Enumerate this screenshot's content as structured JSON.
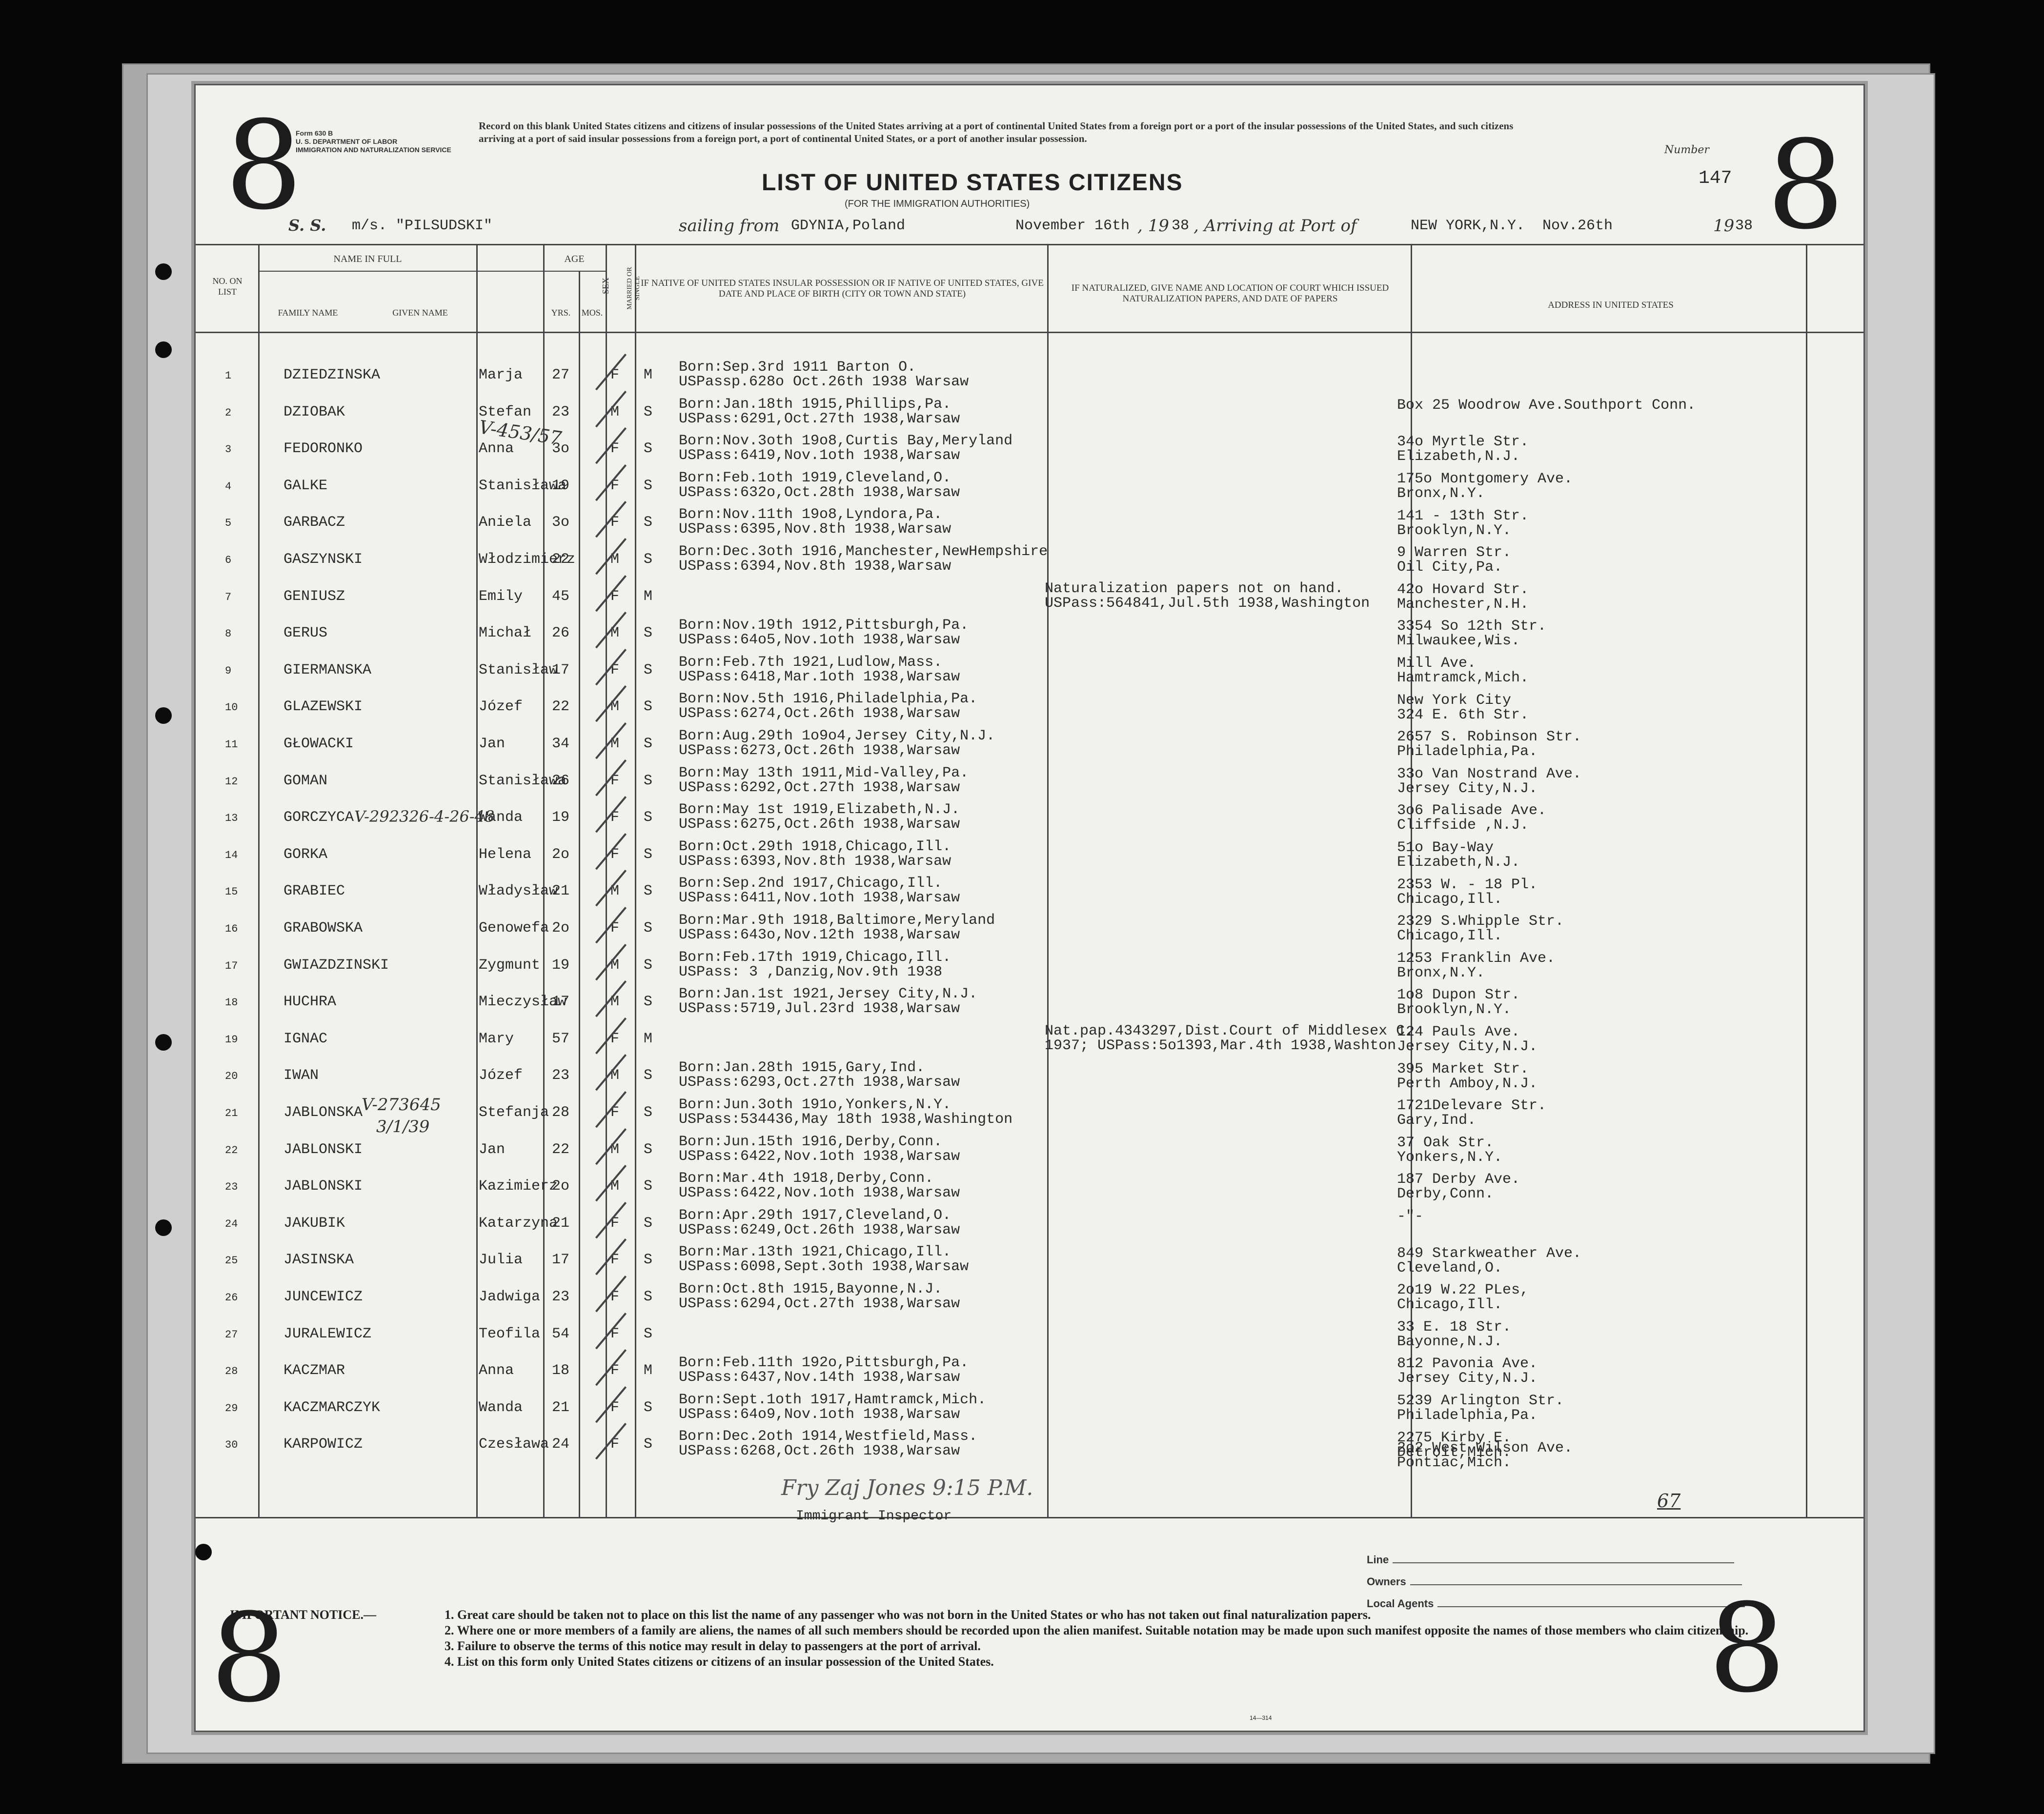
{
  "form": {
    "big_number": "8",
    "form_id": "Form 630 B",
    "dept": "U. S. DEPARTMENT OF LABOR",
    "service": "IMMIGRATION AND NATURALIZATION SERVICE",
    "instructions": "Record on this blank United States citizens and citizens of insular possessions of the United States arriving at a port of continental United States from a foreign port or a port of the insular possessions of the United States, and such citizens arriving at a port of said insular possessions from a foreign port, a port of continental United States, or a port of another insular possession.",
    "number_label": "Number",
    "number_value": "147",
    "title": "LIST OF UNITED STATES CITIZENS",
    "subtitle": "(FOR THE IMMIGRATION AUTHORITIES)",
    "gpo": "14—314"
  },
  "voyage": {
    "ss_label": "S. S.",
    "ship": "m/s. \"PILSUDSKI\"",
    "sailing_label": "sailing from",
    "from": "GDYNIA,Poland",
    "departure_date": "November 16th",
    "year_label": ", 19",
    "departure_year": "38",
    "arriving_label": ", Arriving at Port of",
    "port": "NEW YORK,N.Y.",
    "arrival_date": "Nov.26th",
    "arrival_year": "38"
  },
  "headers": {
    "no": "No. on List",
    "name_in_full": "NAME IN FULL",
    "family": "Family Name",
    "given": "Given Name",
    "age": "AGE",
    "yrs": "Yrs.",
    "mos": "Mos.",
    "sex": "Sex",
    "married": "Married or Single",
    "birth": "If native of United States insular possession or if native of United States, give date and place of birth (city or town and state)",
    "naturalized": "If naturalized, give name and location of court which issued naturalization papers, and date of papers",
    "address": "Address in United States"
  },
  "rows": [
    {
      "no": "1",
      "family": "DZIEDZINSKA",
      "given": "Marja",
      "age": "27",
      "sex": "F",
      "ms": "M",
      "birth": "Born:Sep.3rd 1911 Barton O.",
      "pass": "USPassp.628o Oct.26th 1938 Warsaw",
      "nat1": "",
      "nat2": "",
      "addr1": "",
      "addr2": ""
    },
    {
      "no": "2",
      "family": "DZIOBAK",
      "given": "Stefan",
      "age": "23",
      "sex": "M",
      "ms": "S",
      "birth": "Born:Jan.18th 1915,Phillips,Pa.",
      "pass": "USPass:6291,Oct.27th 1938,Warsaw",
      "nat1": "",
      "nat2": "",
      "addr1": "Box 25 Woodrow Ave.Southport Conn.",
      "addr2": ""
    },
    {
      "no": "3",
      "family": "FEDORONKO",
      "given": "Anna",
      "age": "3o",
      "sex": "F",
      "ms": "S",
      "birth": "Born:Nov.3oth 19o8,Curtis  Bay,Meryland",
      "pass": "USPass:6419,Nov.1oth 1938,Warsaw",
      "nat1": "",
      "nat2": "",
      "addr1": "34o Myrtle Str.",
      "addr2": "Elizabeth,N.J."
    },
    {
      "no": "4",
      "family": "GALKE",
      "given": "Stanisława",
      "age": "19",
      "sex": "F",
      "ms": "S",
      "birth": "Born:Feb.1oth 1919,Cleveland,O.",
      "pass": "USPass:632o,Oct.28th 1938,Warsaw",
      "nat1": "",
      "nat2": "",
      "addr1": "175o Montgomery Ave.",
      "addr2": "Bronx,N.Y."
    },
    {
      "no": "5",
      "family": "GARBACZ",
      "given": "Aniela",
      "age": "3o",
      "sex": "F",
      "ms": "S",
      "birth": "Born:Nov.11th 19o8,Lyndora,Pa.",
      "pass": "USPass:6395,Nov.8th 1938,Warsaw",
      "nat1": "",
      "nat2": "",
      "addr1": "141 - 13th Str.",
      "addr2": "Brooklyn,N.Y."
    },
    {
      "no": "6",
      "family": "GASZYNSKI",
      "given": "Włodzimierz",
      "age": "22",
      "sex": "M",
      "ms": "S",
      "birth": "Born:Dec.3oth 1916,Manchester,NewHempshire",
      "pass": "USPass:6394,Nov.8th 1938,Warsaw",
      "nat1": "",
      "nat2": "",
      "addr1": "9 Warren Str.",
      "addr2": "Oil City,Pa."
    },
    {
      "no": "7",
      "family": "GENIUSZ",
      "given": "Emily",
      "age": "45",
      "sex": "F",
      "ms": "M",
      "birth": "",
      "pass": "",
      "nat1": "Naturalization papers not on hand.",
      "nat2": "USPass:564841,Jul.5th 1938,Washington",
      "addr1": "42o Hovard Str.",
      "addr2": "Manchester,N.H."
    },
    {
      "no": "8",
      "family": "GERUS",
      "given": "Michał",
      "age": "26",
      "sex": "M",
      "ms": "S",
      "birth": "Born:Nov.19th 1912,Pittsburgh,Pa.",
      "pass": "USPass:64o5,Nov.1oth 1938,Warsaw",
      "nat1": "",
      "nat2": "",
      "addr1": "3354 So 12th Str.",
      "addr2": "Milwaukee,Wis."
    },
    {
      "no": "9",
      "family": "GIERMANSKA",
      "given": "Stanisław",
      "age": "17",
      "sex": "F",
      "ms": "S",
      "birth": "Born:Feb.7th 1921,Ludlow,Mass.",
      "pass": "USPass:6418,Mar.1oth 1938,Warsaw",
      "nat1": "",
      "nat2": "",
      "addr1": "Mill Ave.",
      "addr2": "Hamtramck,Mich."
    },
    {
      "no": "10",
      "family": "GLAZEWSKI",
      "given": "Józef",
      "age": "22",
      "sex": "M",
      "ms": "S",
      "birth": "Born:Nov.5th 1916,Philadelphia,Pa.",
      "pass": "USPass:6274,Oct.26th 1938,Warsaw",
      "nat1": "",
      "nat2": "",
      "addr1": "New York City",
      "addr2": "324 E. 6th Str."
    },
    {
      "no": "11",
      "family": "GŁOWACKI",
      "given": "Jan",
      "age": "34",
      "sex": "M",
      "ms": "S",
      "birth": "Born:Aug.29th 1o9o4,Jersey City,N.J.",
      "pass": "USPass:6273,Oct.26th 1938,Warsaw",
      "nat1": "",
      "nat2": "",
      "addr1": "2657 S. Robinson Str.",
      "addr2": "Philadelphia,Pa."
    },
    {
      "no": "12",
      "family": "GOMAN",
      "given": "Stanisława",
      "age": "26",
      "sex": "F",
      "ms": "S",
      "birth": "Born:May 13th 1911,Mid-Valley,Pa.",
      "pass": "USPass:6292,Oct.27th 1938,Warsaw",
      "nat1": "",
      "nat2": "",
      "addr1": "33o Van Nostrand Ave.",
      "addr2": "Jersey City,N.J."
    },
    {
      "no": "13",
      "family": "GORCZYCA",
      "given": "Wanda",
      "age": "19",
      "sex": "F",
      "ms": "S",
      "birth": "Born:May 1st 1919,Elizabeth,N.J.",
      "pass": "USPass:6275,Oct.26th 1938,Warsaw",
      "nat1": "",
      "nat2": "",
      "addr1": "3o6 Palisade Ave.",
      "addr2": "Cliffside ,N.J."
    },
    {
      "no": "14",
      "family": "GORKA",
      "given": "Helena",
      "age": "2o",
      "sex": "F",
      "ms": "S",
      "birth": "Born:Oct.29th 1918,Chicago,Ill.",
      "pass": "USPass:6393,Nov.8th 1938,Warsaw",
      "nat1": "",
      "nat2": "",
      "addr1": "51o Bay-Way",
      "addr2": "Elizabeth,N.J."
    },
    {
      "no": "15",
      "family": "GRABIEC",
      "given": "Władysław",
      "age": "21",
      "sex": "M",
      "ms": "S",
      "birth": "Born:Sep.2nd 1917,Chicago,Ill.",
      "pass": "USPass:6411,Nov.1oth 1938,Warsaw",
      "nat1": "",
      "nat2": "",
      "addr1": "2353 W. - 18 Pl.",
      "addr2": "Chicago,Ill."
    },
    {
      "no": "16",
      "family": "GRABOWSKA",
      "given": "Genowefa",
      "age": "2o",
      "sex": "F",
      "ms": "S",
      "birth": "Born:Mar.9th 1918,Baltimore,Meryland",
      "pass": "USPass:643o,Nov.12th 1938,Warsaw",
      "nat1": "",
      "nat2": "",
      "addr1": "2329 S.Whipple Str.",
      "addr2": "Chicago,Ill."
    },
    {
      "no": "17",
      "family": "GWIAZDZINSKI",
      "given": "Zygmunt",
      "age": "19",
      "sex": "M",
      "ms": "S",
      "birth": "Born:Feb.17th 1919,Chicago,Ill.",
      "pass": "USPass: 3 ,Danzig,Nov.9th 1938",
      "nat1": "",
      "nat2": "",
      "addr1": "1253 Franklin Ave.",
      "addr2": "Bronx,N.Y."
    },
    {
      "no": "18",
      "family": "HUCHRA",
      "given": "Mieczysław",
      "age": "17",
      "sex": "M",
      "ms": "S",
      "birth": "Born:Jan.1st 1921,Jersey City,N.J.",
      "pass": "USPass:5719,Jul.23rd 1938,Warsaw",
      "nat1": "",
      "nat2": "",
      "addr1": "1o8 Dupon Str.",
      "addr2": "Brooklyn,N.Y."
    },
    {
      "no": "19",
      "family": "IGNAC",
      "given": "Mary",
      "age": "57",
      "sex": "F",
      "ms": "M",
      "birth": "",
      "pass": "",
      "nat1": "Nat.pap.4343297,Dist.Court of Middlesex C.",
      "nat2": "1937; USPass:5o1393,Mar.4th 1938,Washton",
      "addr1": "124 Pauls Ave.",
      "addr2": "Jersey City,N.J."
    },
    {
      "no": "20",
      "family": "IWAN",
      "given": "Józef",
      "age": "23",
      "sex": "M",
      "ms": "S",
      "birth": "Born:Jan.28th 1915,Gary,Ind.",
      "pass": "USPass:6293,Oct.27th 1938,Warsaw",
      "nat1": "",
      "nat2": "",
      "addr1": "395 Market Str.",
      "addr2": "Perth Amboy,N.J."
    },
    {
      "no": "21",
      "family": "JABLONSKA",
      "given": "Stefanja",
      "age": "28",
      "sex": "F",
      "ms": "S",
      "birth": "Born:Jun.3oth 191o,Yonkers,N.Y.",
      "pass": "USPass:534436,May 18th 1938,Washington",
      "nat1": "",
      "nat2": "",
      "addr1": "1721Delevare Str.",
      "addr2": "Gary,Ind."
    },
    {
      "no": "22",
      "family": "JABLONSKI",
      "given": "Jan",
      "age": "22",
      "sex": "M",
      "ms": "S",
      "birth": "Born:Jun.15th 1916,Derby,Conn.",
      "pass": "USPass:6422,Nov.1oth 1938,Warsaw",
      "nat1": "",
      "nat2": "",
      "addr1": "37 Oak Str.",
      "addr2": "Yonkers,N.Y."
    },
    {
      "no": "23",
      "family": "JABLONSKI",
      "given": "Kazimierz",
      "age": "2o",
      "sex": "M",
      "ms": "S",
      "birth": "Born:Mar.4th 1918,Derby,Conn.",
      "pass": "USPass:6422,Nov.1oth 1938,Warsaw",
      "nat1": "",
      "nat2": "",
      "addr1": "187 Derby Ave.",
      "addr2": "Derby,Conn."
    },
    {
      "no": "24",
      "family": "JAKUBIK",
      "given": "Katarzyna",
      "age": "21",
      "sex": "F",
      "ms": "S",
      "birth": "Born:Apr.29th 1917,Cleveland,O.",
      "pass": "USPass:6249,Oct.26th 1938,Warsaw",
      "nat1": "",
      "nat2": "",
      "addr1": "-\"-",
      "addr2": ""
    },
    {
      "no": "25",
      "family": "JASINSKA",
      "given": "Julia",
      "age": "17",
      "sex": "F",
      "ms": "S",
      "birth": "Born:Mar.13th 1921,Chicago,Ill.",
      "pass": "USPass:6098,Sept.3oth 1938,Warsaw",
      "nat1": "",
      "nat2": "",
      "addr1": "849 Starkweather Ave.",
      "addr2": "Cleveland,O."
    },
    {
      "no": "26",
      "family": "JUNCEWICZ",
      "given": "Jadwiga",
      "age": "23",
      "sex": "F",
      "ms": "S",
      "birth": "Born:Oct.8th 1915,Bayonne,N.J.",
      "pass": "USPass:6294,Oct.27th 1938,Warsaw",
      "nat1": "",
      "nat2": "",
      "addr1": "2o19 W.22 PLes,",
      "addr2": "Chicago,Ill."
    },
    {
      "no": "27",
      "family": "JURALEWICZ",
      "given": "Teofila",
      "age": "54",
      "sex": "F",
      "ms": "S",
      "birth": "",
      "pass": "",
      "nat1": "",
      "nat2": "",
      "addr1": "33 E. 18 Str.",
      "addr2": "Bayonne,N.J."
    },
    {
      "no": "28",
      "family": "KACZMAR",
      "given": "Anna",
      "age": "18",
      "sex": "F",
      "ms": "M",
      "birth": "Born:Feb.11th 192o,Pittsburgh,Pa.",
      "pass": "USPass:6437,Nov.14th 1938,Warsaw",
      "nat1": "",
      "nat2": "",
      "addr1": "812 Pavonia Ave.",
      "addr2": "Jersey City,N.J."
    },
    {
      "no": "29",
      "family": "KACZMARCZYK",
      "given": "Wanda",
      "age": "21",
      "sex": "F",
      "ms": "S",
      "birth": "Born:Sept.1oth 1917,Hamtramck,Mich.",
      "pass": "USPass:64o9,Nov.1oth 1938,Warsaw",
      "nat1": "",
      "nat2": "",
      "addr1": "5239 Arlington Str.",
      "addr2": "Philadelphia,Pa."
    },
    {
      "no": "30",
      "family": "KARPOWICZ",
      "given": "Czesława",
      "age": "24",
      "sex": "F",
      "ms": "S",
      "birth": "Born:Dec.2oth 1914,Westfield,Mass.",
      "pass": "USPass:6268,Oct.26th 1938,Warsaw",
      "nat1": "",
      "nat2": "",
      "addr1": "2275 Kirby E.",
      "addr2": "Detroit,Mich."
    }
  ],
  "last_address": {
    "addr1": "2o2 West Wilson Ave.",
    "addr2": "Pontiac,Mich."
  },
  "annotations": {
    "anna": "V-453/57",
    "gorczyca": "V-292326-4-26-48",
    "jablonska1": "V-273645",
    "jablonska2": "3/1/39",
    "page_total": "67",
    "inspector_sig": "Fry Zaj Jones  9:15 P.M.",
    "inspector_label": "Immigrant Inspector"
  },
  "footer_fields": {
    "line": "Line",
    "owners": "Owners",
    "agents": "Local Agents"
  },
  "notice": {
    "heading": "IMPORTANT NOTICE.—",
    "n1": "1. Great care should be taken not to place on this list the name of any passenger who was not born in the United States or who has not taken out final naturalization papers.",
    "n2": "2. Where one or more members of a family are aliens, the names of all such members should be recorded upon the alien manifest. Suitable notation may be made upon such manifest opposite the names of those members who claim citizenship.",
    "n3": "3. Failure to observe the terms of this notice may result in delay to passengers at the port of arrival.",
    "n4": "4. List on this form only United States citizens or citizens of an insular possession of the United States."
  }
}
